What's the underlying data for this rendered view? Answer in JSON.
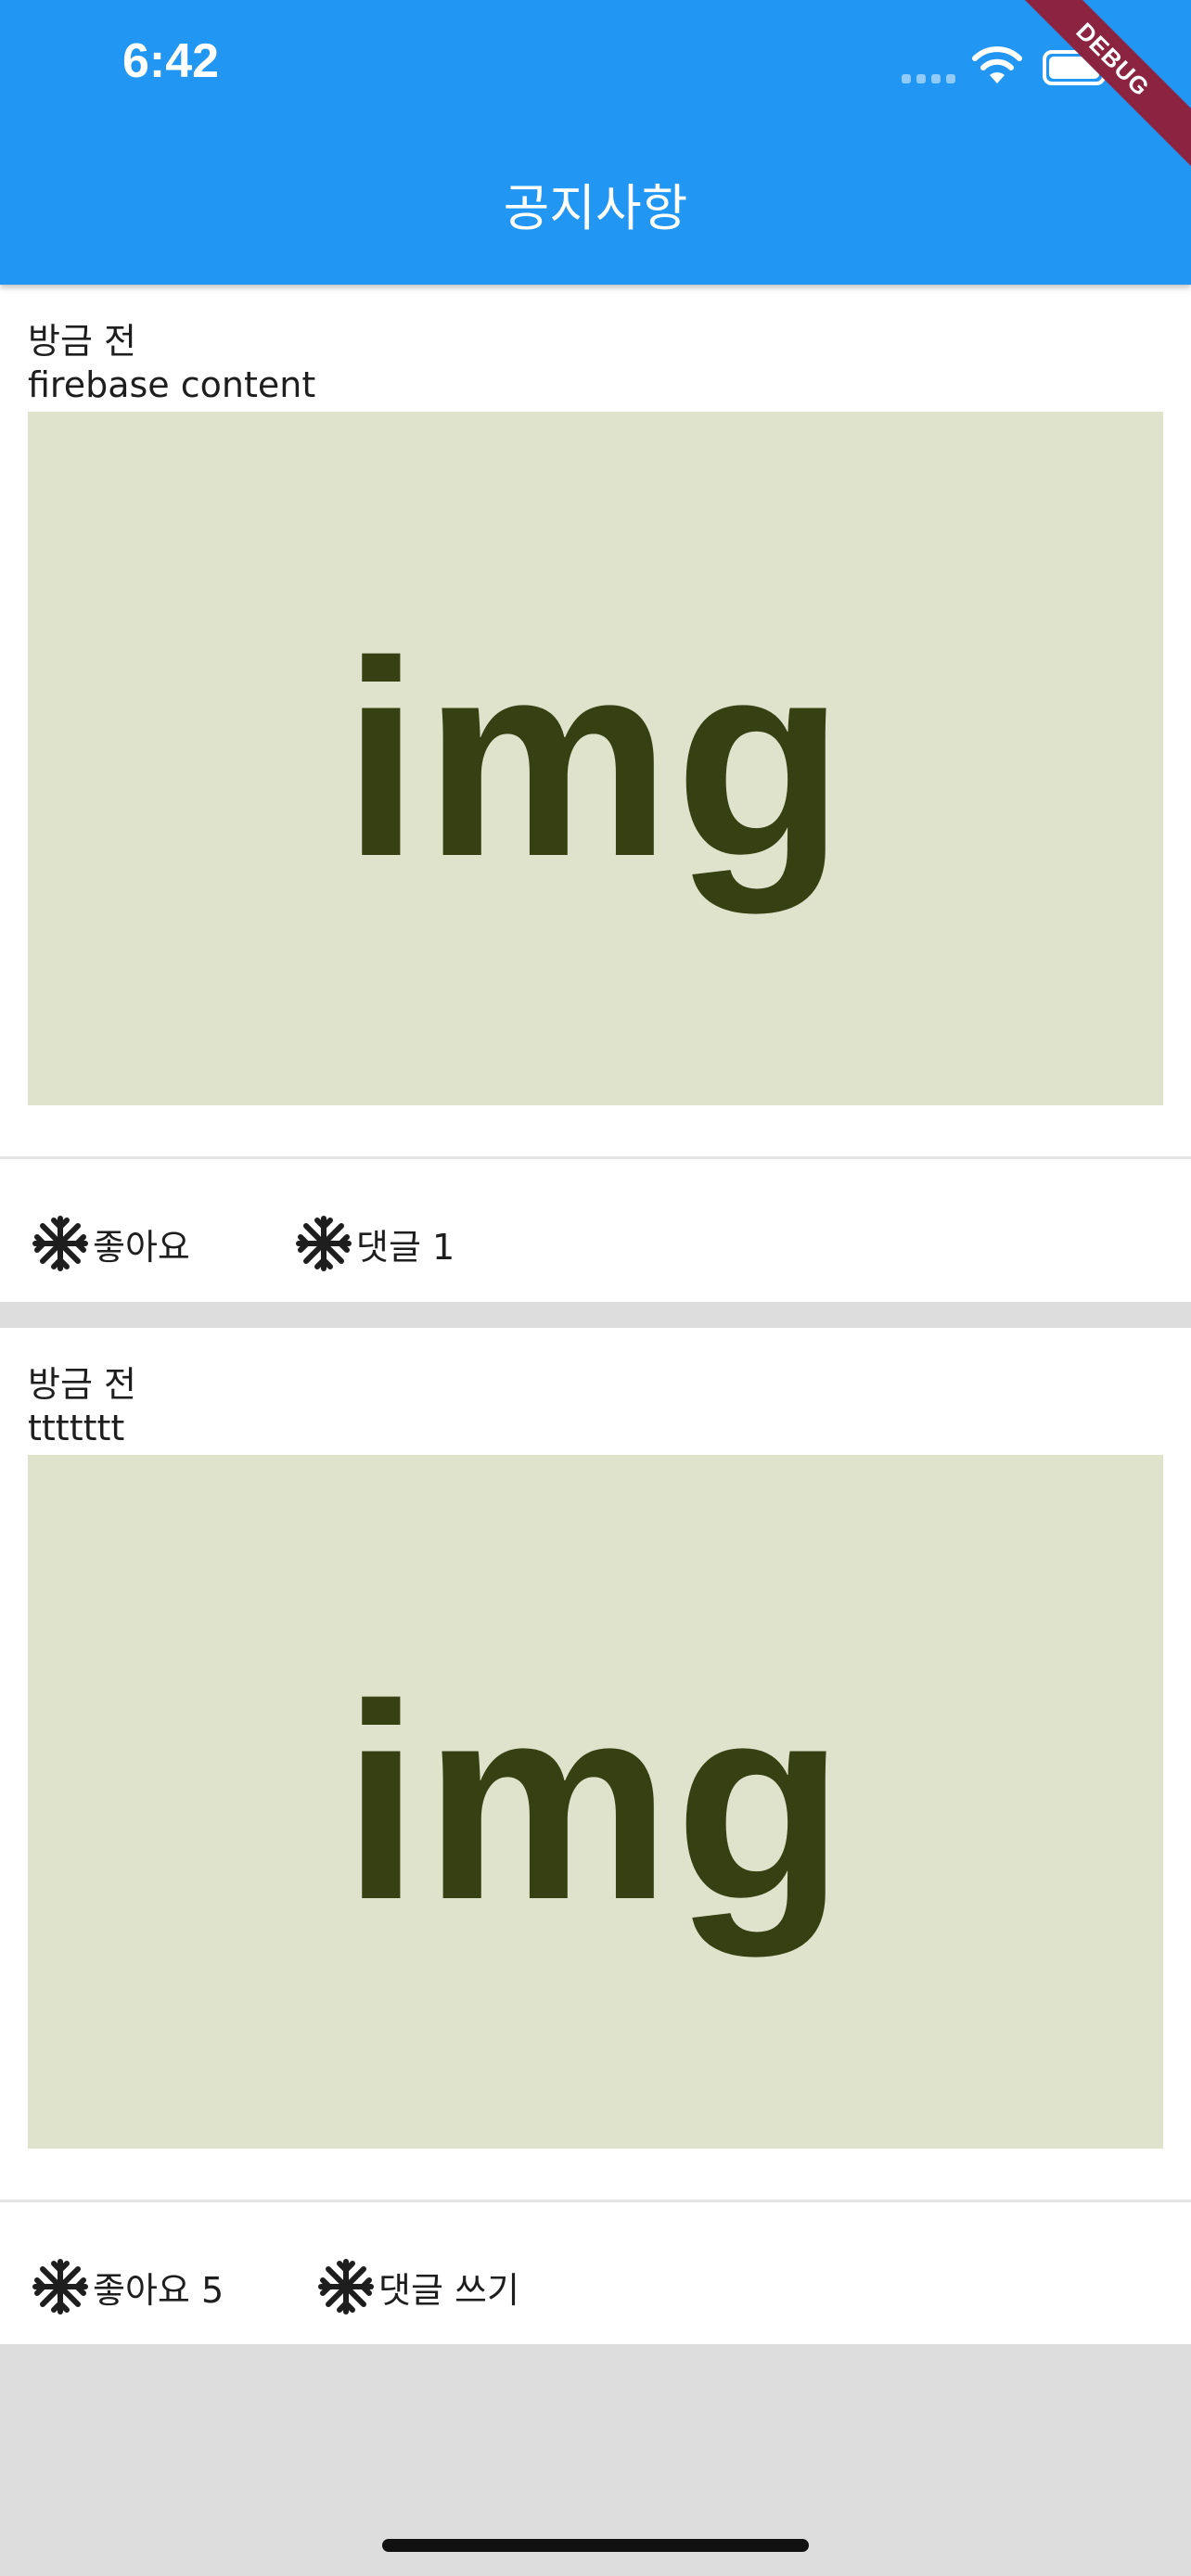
{
  "status_bar": {
    "time": "6:42"
  },
  "debug_banner": "DEBUG",
  "appbar": {
    "title": "공지사항"
  },
  "posts": [
    {
      "time": "방금 전",
      "content": "firebase content",
      "image_text": "img",
      "like_label": "좋아요",
      "comment_label": "댓글 1"
    },
    {
      "time": "방금 전",
      "content": "ttttttt",
      "image_text": "img",
      "like_label": "좋아요 5",
      "comment_label": "댓글 쓰기"
    }
  ],
  "colors": {
    "appbar": "#2196f3",
    "image_bg": "#dfe3cc",
    "image_text": "#374013",
    "background": "#dddddd",
    "debug": "#8a2440"
  },
  "icons": {
    "action_icon": "snowflake-icon"
  }
}
